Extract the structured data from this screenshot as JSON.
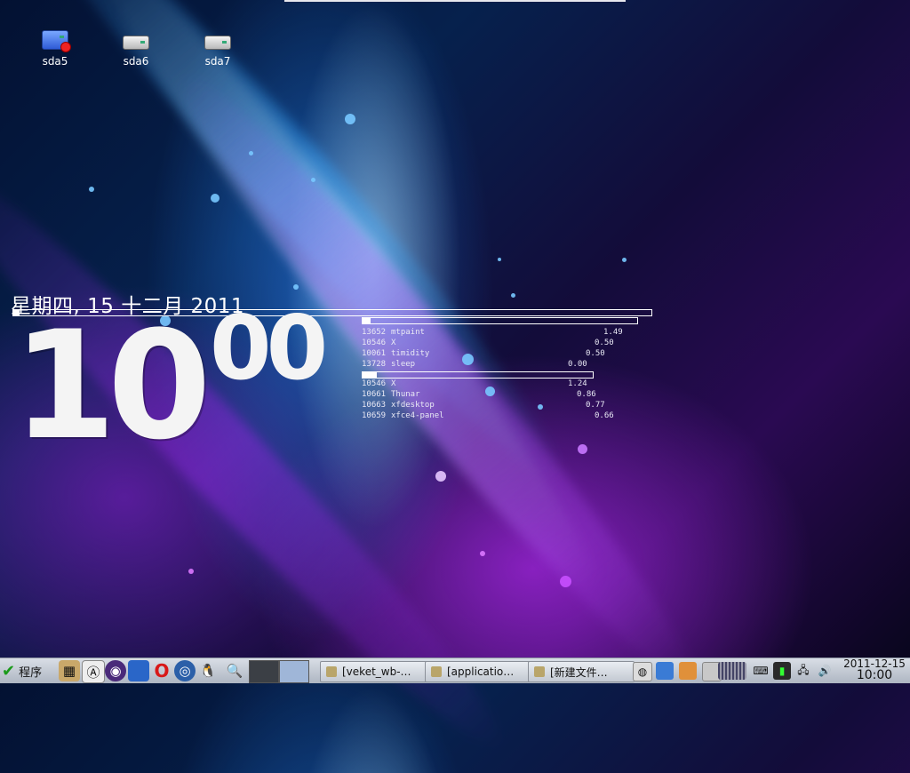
{
  "desktop": {
    "icons": [
      {
        "label": "sda5",
        "icon": "drive-red-badge-icon"
      },
      {
        "label": "sda6",
        "icon": "drive-icon"
      },
      {
        "label": "sda7",
        "icon": "drive-icon"
      }
    ]
  },
  "conky": {
    "date_text": "星期四, 15 十二月 2011",
    "time_hour": "10",
    "time_minutes": "00",
    "cpu_bar_fill": 0.01,
    "cpu_processes": {
      "bar_fill": 0.03,
      "rows": [
        {
          "pid": "13652",
          "name": "mtpaint",
          "value": "1.49"
        },
        {
          "pid": "10546",
          "name": "X",
          "value": "0.50"
        },
        {
          "pid": "10061",
          "name": "timidity",
          "value": "0.50"
        },
        {
          "pid": "13728",
          "name": "sleep",
          "value": "0.00"
        }
      ]
    },
    "mem_processes": {
      "bar_fill": 0.06,
      "rows": [
        {
          "pid": "10546",
          "name": "X",
          "value": "1.24"
        },
        {
          "pid": "10661",
          "name": "Thunar",
          "value": "0.86"
        },
        {
          "pid": "10663",
          "name": "xfdesktop",
          "value": "0.77"
        },
        {
          "pid": "10659",
          "name": "xfce4-panel",
          "value": "0.66"
        }
      ]
    }
  },
  "taskbar": {
    "start_label": "程序",
    "tasks": [
      {
        "label": "[veket_wb-…"
      },
      {
        "label": "[applicatio…"
      },
      {
        "label": "[新建文件…"
      }
    ],
    "clock_date": "2011-12-15",
    "clock_time": "10:00",
    "colors": {
      "accent": "#1a9a1a",
      "panel": "#c3c9d2"
    }
  }
}
